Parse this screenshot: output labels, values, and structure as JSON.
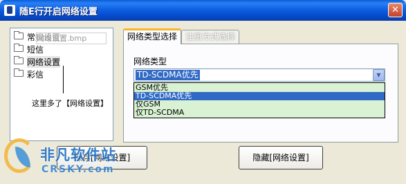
{
  "window": {
    "title": "随E行开启网络设置",
    "close_glyph": "✕"
  },
  "tree": {
    "items": [
      {
        "label": "常规设置",
        "icon": "folder-icon"
      },
      {
        "label": "短信",
        "icon": "folder-icon"
      },
      {
        "label": "网络设置",
        "icon": "folder-icon"
      },
      {
        "label": "彩信",
        "icon": "folder-icon"
      }
    ]
  },
  "ghost_drag_label": "网络设置.bmp",
  "annotation": "这里多了【网络设置】",
  "tabs": [
    {
      "label": "网络类型选择"
    },
    {
      "label": "注册方式选择"
    }
  ],
  "network": {
    "field_label": "网络类型",
    "selected": "TD-SCDMA优先",
    "options": [
      "GSM优先",
      "TD-SCDMA优先",
      "仅GSM",
      "仅TD-SCDMA"
    ],
    "highlighted_index": 1
  },
  "buttons": {
    "left": "保存[网络设置]",
    "right": "隐藏[网络设置]"
  },
  "watermark": {
    "main": "非凡软件站",
    "sub": "CRSKY.com"
  },
  "colors": {
    "title_bar": "#0a5fd8",
    "selection": "#316ac5",
    "dropdown_bg": "#d9f2d3",
    "tab_accent": "#f8b52c"
  }
}
